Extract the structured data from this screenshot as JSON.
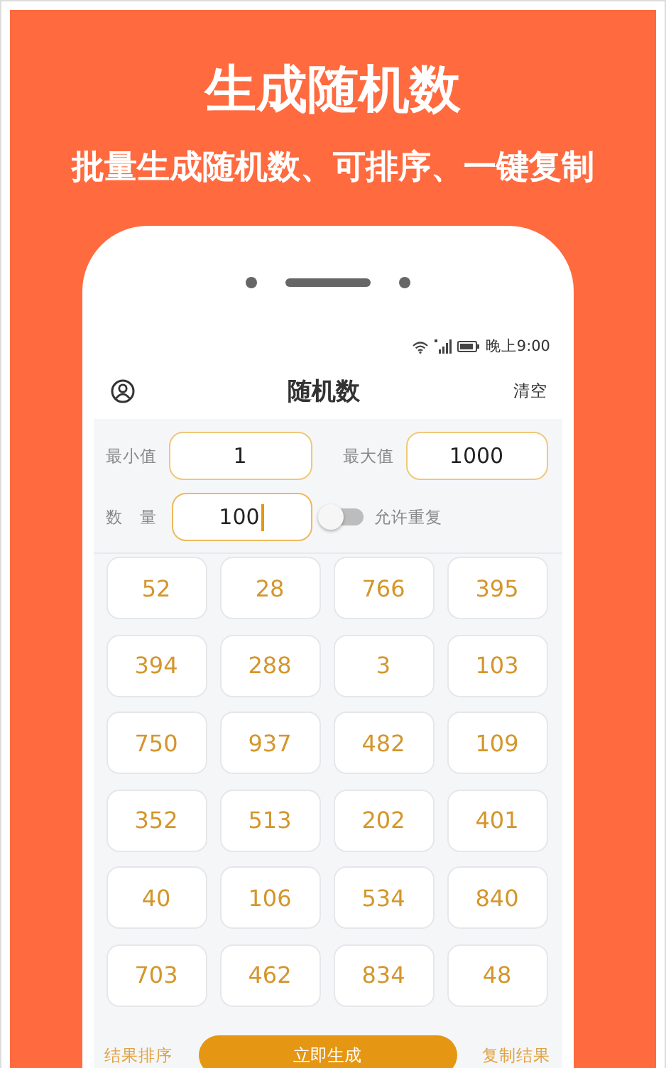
{
  "promo": {
    "title": "生成随机数",
    "subtitle": "批量生成随机数、可排序、一键复制"
  },
  "status_bar": {
    "time": "晚上9:00"
  },
  "header": {
    "title": "随机数",
    "action": "清空"
  },
  "form": {
    "min": {
      "label": "最小值",
      "value": "1"
    },
    "max": {
      "label": "最大值",
      "value": "1000"
    },
    "count": {
      "label": "数　量",
      "value": "100",
      "focused": true
    },
    "repeat": {
      "label": "允许重复",
      "on": false
    }
  },
  "results": [
    "52",
    "28",
    "766",
    "395",
    "394",
    "288",
    "3",
    "103",
    "750",
    "937",
    "482",
    "109",
    "352",
    "513",
    "202",
    "401",
    "40",
    "106",
    "534",
    "840",
    "703",
    "462",
    "834",
    "48"
  ],
  "bottom_bar": {
    "sort": "结果排序",
    "generate": "立即生成",
    "copy": "复制结果"
  }
}
